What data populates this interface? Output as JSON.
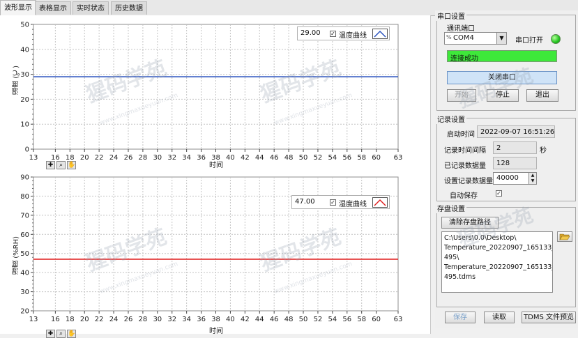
{
  "tabs": [
    {
      "label": "波形显示",
      "active": true
    },
    {
      "label": "表格显示",
      "active": false
    },
    {
      "label": "实时状态",
      "active": false
    },
    {
      "label": "历史数据",
      "active": false
    }
  ],
  "temp_chart": {
    "legend_value": "29.00",
    "legend_label": "温度曲线",
    "legend_checked": true,
    "ylabel": "温度 (℃)",
    "xlabel": "时间",
    "line_color": "#2a52be",
    "ytick_labels": [
      "0",
      "10",
      "20",
      "30",
      "40",
      "50"
    ],
    "xtick_labels": [
      "13",
      "16",
      "18",
      "20",
      "22",
      "24",
      "26",
      "28",
      "30",
      "32",
      "34",
      "36",
      "38",
      "40",
      "42",
      "44",
      "46",
      "48",
      "50",
      "52",
      "54",
      "56",
      "58",
      "60",
      "63"
    ]
  },
  "hum_chart": {
    "legend_value": "47.00",
    "legend_label": "湿度曲线",
    "legend_checked": true,
    "ylabel": "湿度 (%RH)",
    "xlabel": "时间",
    "line_color": "#e02020",
    "ytick_labels": [
      "20",
      "30",
      "40",
      "50",
      "60",
      "70",
      "80",
      "90"
    ],
    "xtick_labels": [
      "13",
      "16",
      "18",
      "20",
      "22",
      "24",
      "26",
      "28",
      "30",
      "32",
      "34",
      "36",
      "38",
      "40",
      "42",
      "44",
      "46",
      "48",
      "50",
      "52",
      "54",
      "56",
      "58",
      "60",
      "63"
    ]
  },
  "chart_data": [
    {
      "type": "line",
      "ylabel": "温度 (℃)",
      "xlabel": "时间",
      "xlim": [
        13,
        63
      ],
      "ylim": [
        0,
        50
      ],
      "series": [
        {
          "name": "温度曲线",
          "x": [
            13,
            63
          ],
          "values": [
            29,
            29
          ]
        }
      ]
    },
    {
      "type": "line",
      "ylabel": "湿度 (%RH)",
      "xlabel": "时间",
      "xlim": [
        13,
        63
      ],
      "ylim": [
        20,
        90
      ],
      "series": [
        {
          "name": "湿度曲线",
          "x": [
            13,
            63
          ],
          "values": [
            47,
            47
          ]
        }
      ]
    }
  ],
  "serial": {
    "group_title": "串口设置",
    "port_label": "通讯端口",
    "port_value": "COM4",
    "port_prefix": "%",
    "open_label": "串口打开",
    "status_text": "连接成功",
    "close_port_label": "关闭串口",
    "start_label": "开始",
    "stop_label": "停止",
    "exit_label": "退出",
    "led_color": "#22c41f",
    "status_color": "#3ee83a"
  },
  "record": {
    "group_title": "记录设置",
    "start_time_label": "启动时间",
    "start_time_value": "2022-09-07 16:51:26",
    "interval_label": "记录时间间隔",
    "interval_value": "2",
    "interval_unit": "秒",
    "count_label": "已记录数据量",
    "count_value": "128",
    "set_count_label": "设置记录数据量",
    "set_count_value": "40000",
    "autosave_label": "自动保存",
    "autosave_checked": true
  },
  "storage": {
    "group_title": "存盘设置",
    "clear_path_label": "清除存盘路径",
    "path_lines": [
      "C:\\Users\\0.0\\Desktop\\",
      "Temperature_20220907_165133_",
      "495\\",
      "Temperature_20220907_165133_",
      "495.tdms"
    ]
  },
  "bottom_buttons": {
    "save_label": "保存",
    "read_label": "读取",
    "tdms_label": "TDMS 文件预览"
  },
  "watermark": {
    "main": "猩码学苑",
    "sub": "www.xingmaxueyuan.com"
  }
}
